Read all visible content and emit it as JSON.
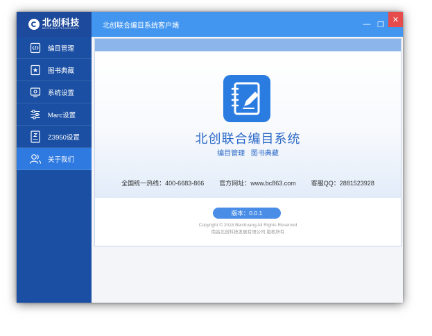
{
  "app": {
    "window_title": "北创联合编目系统客户端",
    "logo_name": "北创科技",
    "logo_sub": "BEICHUANG TECHNOLOGY"
  },
  "sidebar": {
    "items": [
      {
        "label": "编目管理",
        "icon": "code-editor-icon"
      },
      {
        "label": "图书典藏",
        "icon": "star-book-icon"
      },
      {
        "label": "系统设置",
        "icon": "monitor-settings-icon"
      },
      {
        "label": "Marc设置",
        "icon": "sliders-icon"
      },
      {
        "label": "Z3950设置",
        "icon": "z3950-doc-icon"
      },
      {
        "label": "关于我们",
        "icon": "users-icon",
        "active": true
      }
    ]
  },
  "window_controls": {
    "minimize": "—",
    "maximize": "❐",
    "close": "✕"
  },
  "about": {
    "app_name": "北创联合编目系统",
    "tagline": "编目管理 图书典藏",
    "hotline": "全国统一热线：400-6683-866",
    "website": "官方网址：www.bc863.com",
    "qq": "客服QQ：2881523928",
    "version": "版本：0.0.1",
    "copyright": "Copyright © 2018 Beichuang All Rights Reserved",
    "company": "南昌北创科技发展有限公司 版权所有"
  },
  "colors": {
    "sidebar_bg": "#1a4fa3",
    "titlebar_bg": "#4296f0",
    "accent": "#2d6ac8",
    "active_item": "#2f7ae0",
    "close_button": "#e74c4c"
  }
}
